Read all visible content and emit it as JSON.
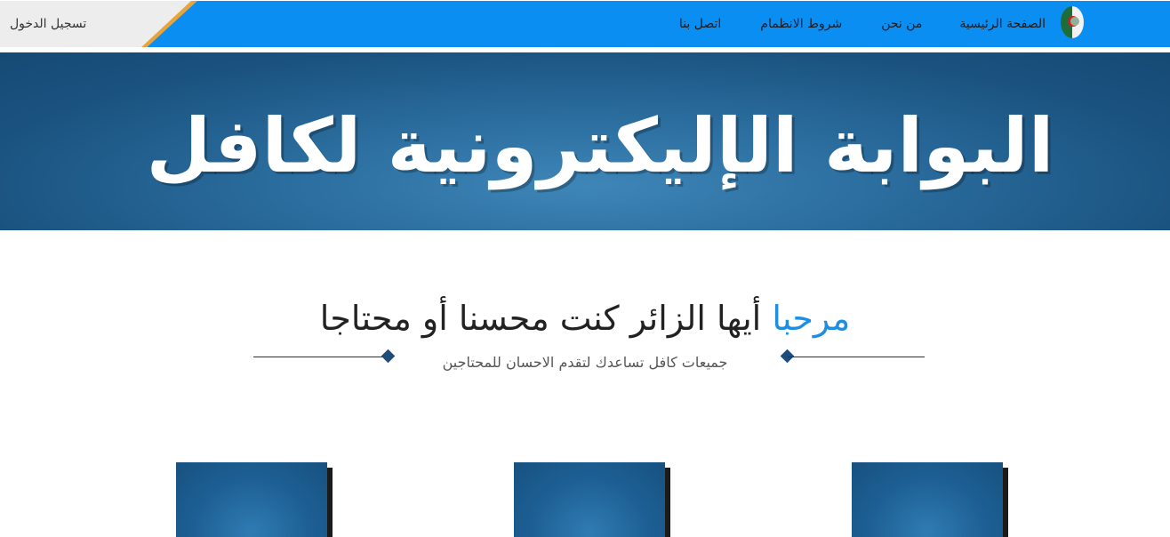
{
  "nav": {
    "login_label": "تسجيل الدخول",
    "items": [
      {
        "label": "الصفحة الرئيسية"
      },
      {
        "label": "من نحن"
      },
      {
        "label": "شروط الانظمام"
      },
      {
        "label": "اتصل بنا"
      }
    ],
    "logo_icon": "algeria-flag-icon"
  },
  "banner": {
    "title": "البوابة الإليكترونية لكافل"
  },
  "welcome": {
    "accent": "مرحبا",
    "heading": "أيها الزائر كنت محسنا أو محتاجا",
    "tagline": "جميعات كافل تساعدك لتقدم الاحسان للمحتاجين"
  },
  "colors": {
    "nav_blue": "#0a8ef2",
    "accent_blue": "#1c8fe3",
    "banner_blue": "#1a527f",
    "stripe_orange": "#e8a33a"
  }
}
